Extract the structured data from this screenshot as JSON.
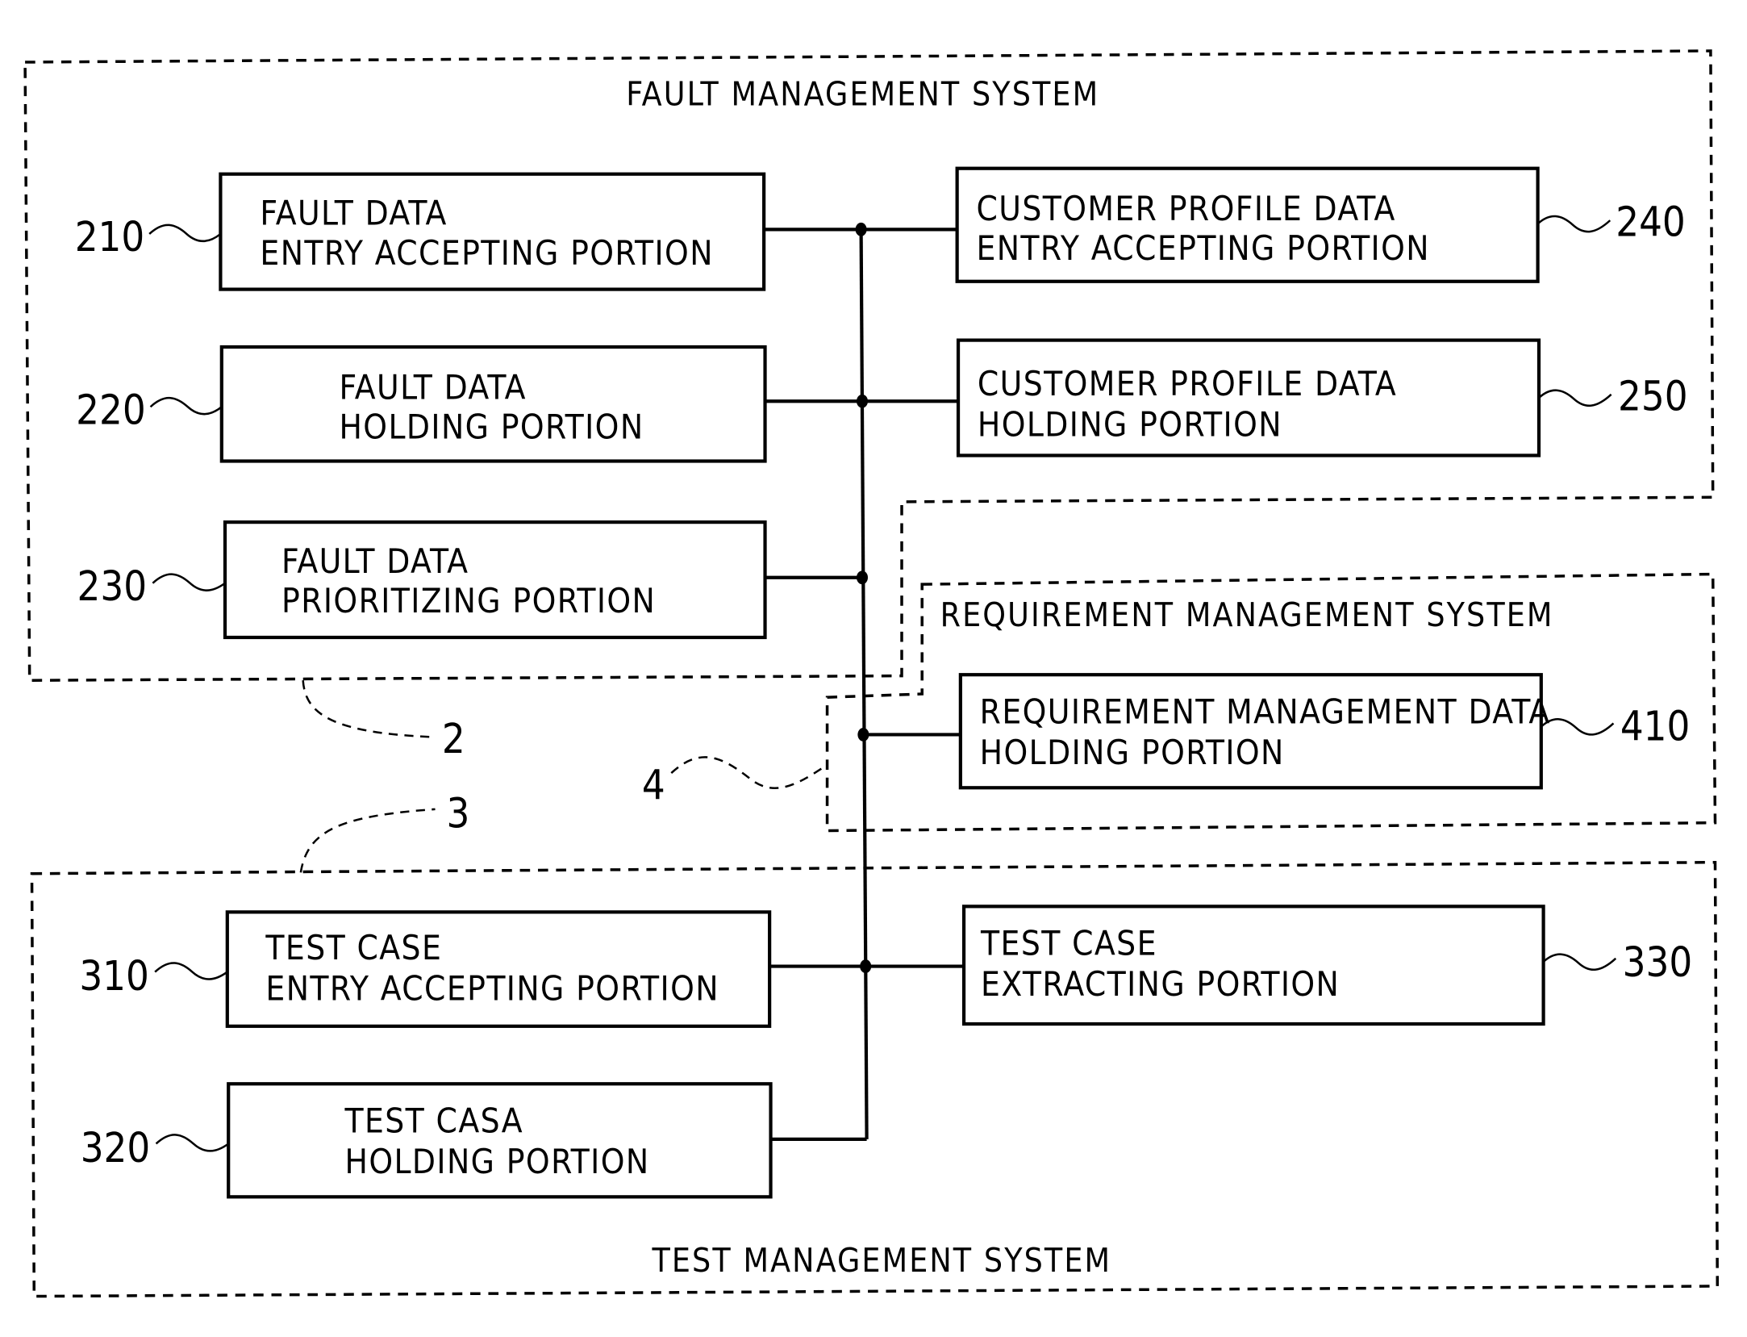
{
  "systems": {
    "fault": {
      "title": "FAULT MANAGEMENT SYSTEM",
      "ref": "2"
    },
    "test": {
      "title": "TEST MANAGEMENT SYSTEM",
      "ref": "3"
    },
    "requirement": {
      "title": "REQUIREMENT MANAGEMENT SYSTEM",
      "ref": "4"
    }
  },
  "blocks": {
    "b210": {
      "ref": "210",
      "line1": "FAULT DATA",
      "line2": "ENTRY ACCEPTING PORTION"
    },
    "b220": {
      "ref": "220",
      "line1": "FAULT DATA",
      "line2": "HOLDING PORTION"
    },
    "b230": {
      "ref": "230",
      "line1": "FAULT DATA",
      "line2": "PRIORITIZING PORTION"
    },
    "b240": {
      "ref": "240",
      "line1": "CUSTOMER PROFILE DATA",
      "line2": "ENTRY ACCEPTING PORTION"
    },
    "b250": {
      "ref": "250",
      "line1": "CUSTOMER PROFILE DATA",
      "line2": "HOLDING PORTION"
    },
    "b410": {
      "ref": "410",
      "line1": "REQUIREMENT MANAGEMENT DATA",
      "line2": "HOLDING PORTION"
    },
    "b310": {
      "ref": "310",
      "line1": "TEST CASE",
      "line2": "ENTRY ACCEPTING PORTION"
    },
    "b320": {
      "ref": "320",
      "line1": "TEST CASA",
      "line2": "HOLDING PORTION"
    },
    "b330": {
      "ref": "330",
      "line1": "TEST CASE",
      "line2": "EXTRACTING PORTION"
    }
  }
}
